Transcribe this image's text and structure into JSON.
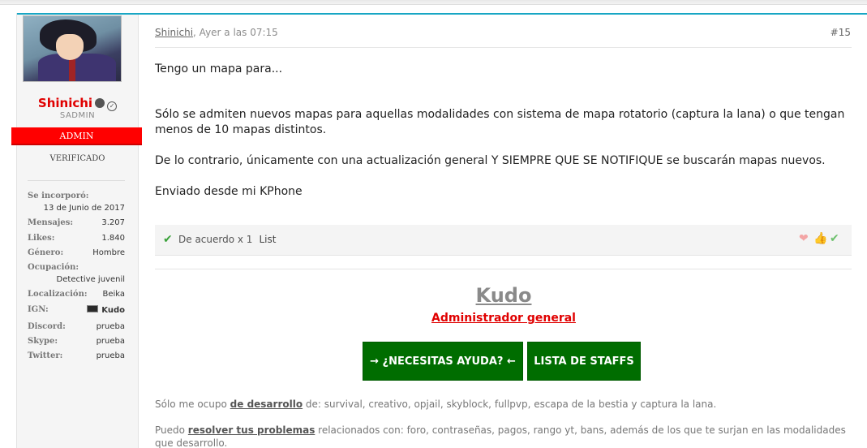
{
  "user": {
    "name": "Shinichi",
    "title": "SADMIN",
    "banner": "ADMIN",
    "verified": "VERIFICADO",
    "info": [
      {
        "key": "Se incorporó:",
        "value": "13 de Junio de 2017"
      },
      {
        "key": "Mensajes:",
        "value": "3.207"
      },
      {
        "key": "Likes:",
        "value": "1.840"
      },
      {
        "key": "Género:",
        "value": "Hombre"
      },
      {
        "key": "Ocupación:",
        "value": "Detective juvenil"
      },
      {
        "key": "Localización:",
        "value": "Beika"
      },
      {
        "key": "IGN:",
        "value": "Kudo"
      },
      {
        "key": "Discord:",
        "value": "prueba"
      },
      {
        "key": "Skype:",
        "value": "prueba"
      },
      {
        "key": "Twitter:",
        "value": "prueba"
      }
    ]
  },
  "post": {
    "author": "Shinichi",
    "date": ", Ayer a las 07:15",
    "number": "#15",
    "quote": "Tengo un mapa para...",
    "para1": "Sólo se admiten nuevos mapas para aquellas modalidades con sistema de mapa rotatorio (captura la lana) o que tengan menos de 10 mapas distintos.",
    "para2": "De lo contrario, únicamente con una actualización general Y SIEMPRE QUE SE NOTIFIQUE se buscarán mapas nuevos.",
    "para3": "Enviado desde mi KPhone"
  },
  "likes": {
    "text": "De acuerdo x 1",
    "list_label": "List",
    "reaction_icons": [
      "heart-icon",
      "thumbs-up-icon",
      "check-icon"
    ],
    "accent": "#3aa13a"
  },
  "signature": {
    "name": "Kudo",
    "role": "Administrador general",
    "help_button": "→ ¿NECESITAS AYUDA? ←",
    "staff_button": "LISTA DE STAFFS",
    "line1_pre": "Sólo me ocupo ",
    "line1_link": "de desarrollo",
    "line1_post": " de: survival, creativo, opjail, skyblock, fullpvp, escapa de la bestia y captura la lana.",
    "line2_pre": "Puedo ",
    "line2_link": "resolver tus problemas",
    "line2_post": " relacionados con: foro, contraseñas, pagos, rango yt, bans, además de los que te surjan en las modalidades que desarrollo."
  },
  "colors": {
    "accent_line": "#18a6c4",
    "admin_red": "#ff0000",
    "button_green": "#006d00"
  }
}
